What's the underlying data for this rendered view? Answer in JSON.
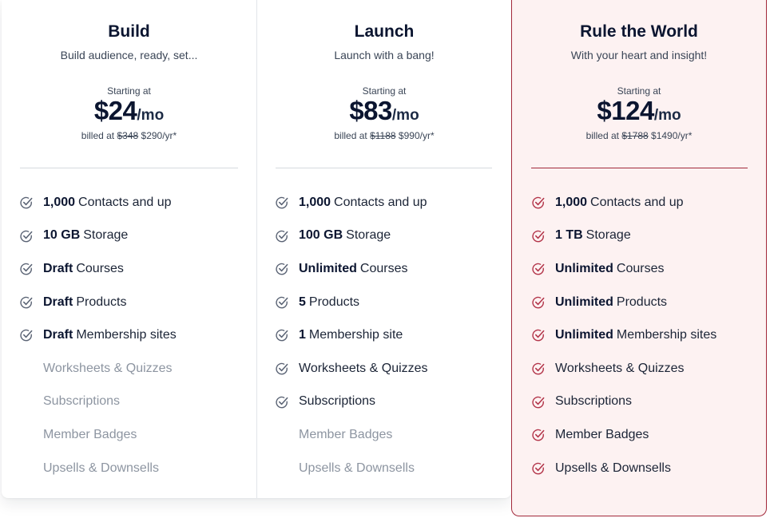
{
  "plans": [
    {
      "name": "Build",
      "tagline": "Build audience, ready, set...",
      "starting_label": "Starting at",
      "price": "$24",
      "period": "/mo",
      "billed_prefix": "billed at",
      "old_price": "$348",
      "new_price": "$290/yr*",
      "check_color": "#5b6475",
      "features": [
        {
          "bold": "1,000",
          "text": "Contacts and up",
          "included": true
        },
        {
          "bold": "10 GB",
          "text": "Storage",
          "included": true
        },
        {
          "bold": "Draft",
          "text": "Courses",
          "included": true
        },
        {
          "bold": "Draft",
          "text": "Products",
          "included": true
        },
        {
          "bold": "Draft",
          "text": "Membership sites",
          "included": true
        },
        {
          "bold": "",
          "text": "Worksheets & Quizzes",
          "included": false
        },
        {
          "bold": "",
          "text": "Subscriptions",
          "included": false
        },
        {
          "bold": "",
          "text": "Member Badges",
          "included": false
        },
        {
          "bold": "",
          "text": "Upsells & Downsells",
          "included": false
        }
      ]
    },
    {
      "name": "Launch",
      "tagline": "Launch with a bang!",
      "starting_label": "Starting at",
      "price": "$83",
      "period": "/mo",
      "billed_prefix": "billed at",
      "old_price": "$1188",
      "new_price": "$990/yr*",
      "check_color": "#5b6475",
      "features": [
        {
          "bold": "1,000",
          "text": "Contacts and up",
          "included": true
        },
        {
          "bold": "100 GB",
          "text": "Storage",
          "included": true
        },
        {
          "bold": "Unlimited",
          "text": "Courses",
          "included": true
        },
        {
          "bold": "5",
          "text": "Products",
          "included": true
        },
        {
          "bold": "1",
          "text": "Membership site",
          "included": true
        },
        {
          "bold": "",
          "text": "Worksheets & Quizzes",
          "included": true
        },
        {
          "bold": "",
          "text": "Subscriptions",
          "included": true
        },
        {
          "bold": "",
          "text": "Member Badges",
          "included": false
        },
        {
          "bold": "",
          "text": "Upsells & Downsells",
          "included": false
        }
      ]
    },
    {
      "name": "Rule the World",
      "tagline": "With your heart and insight!",
      "starting_label": "Starting at",
      "price": "$124",
      "period": "/mo",
      "billed_prefix": "billed at",
      "old_price": "$1788",
      "new_price": "$1490/yr*",
      "check_color": "#b3354a",
      "features": [
        {
          "bold": "1,000",
          "text": "Contacts and up",
          "included": true
        },
        {
          "bold": "1 TB",
          "text": "Storage",
          "included": true
        },
        {
          "bold": "Unlimited",
          "text": "Courses",
          "included": true
        },
        {
          "bold": "Unlimited",
          "text": "Products",
          "included": true
        },
        {
          "bold": "Unlimited",
          "text": "Membership sites",
          "included": true
        },
        {
          "bold": "",
          "text": "Worksheets & Quizzes",
          "included": true
        },
        {
          "bold": "",
          "text": "Subscriptions",
          "included": true
        },
        {
          "bold": "",
          "text": "Member Badges",
          "included": true
        },
        {
          "bold": "",
          "text": "Upsells & Downsells",
          "included": true
        }
      ]
    }
  ],
  "colors": {
    "highlight_border": "#a2283a",
    "highlight_bg": "#fdf2f2",
    "muted_text": "#8d95a1"
  }
}
